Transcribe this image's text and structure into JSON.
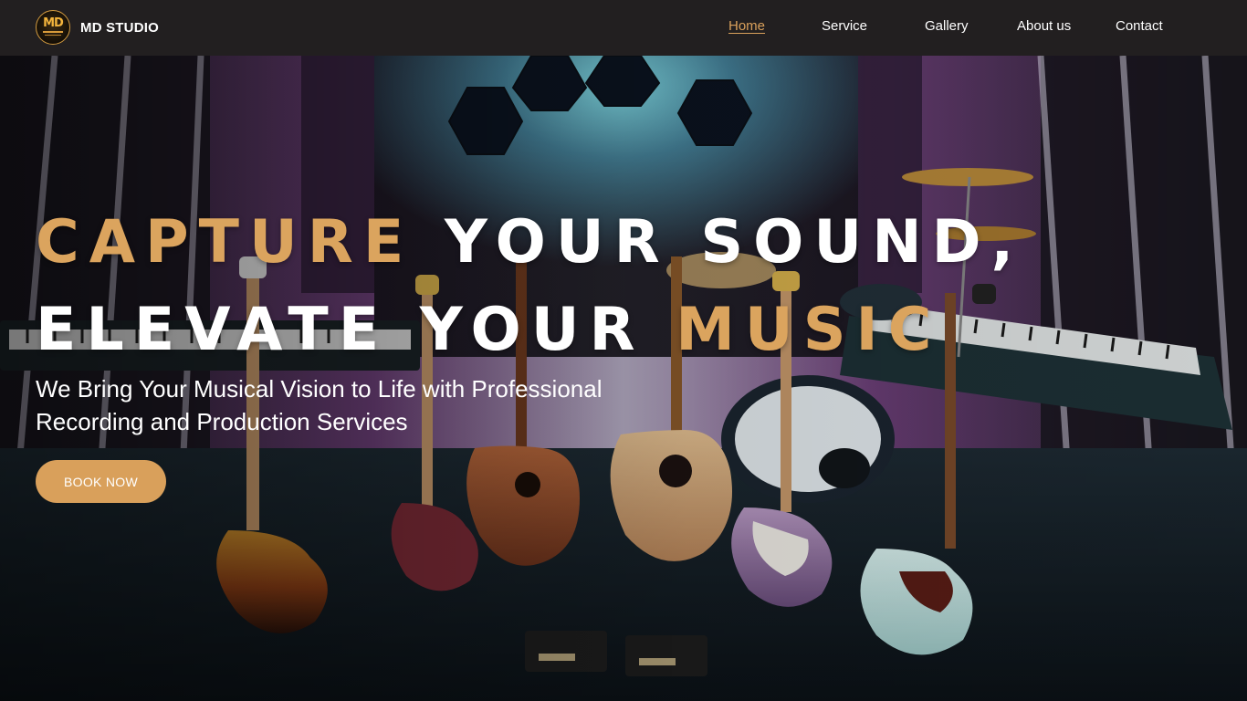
{
  "brand": {
    "logo_text": "MD",
    "name": "MD STUDIO"
  },
  "nav": {
    "items": [
      {
        "label": "Home",
        "active": true
      },
      {
        "label": "Service",
        "active": false
      },
      {
        "label": "Gallery",
        "active": false
      },
      {
        "label": "About us",
        "active": false
      },
      {
        "label": "Contact",
        "active": false
      }
    ]
  },
  "hero": {
    "headline": {
      "line1_gold": "CAPTURE",
      "line1_white": "YOUR SOUND,",
      "line2_white": "ELEVATE YOUR",
      "line2_gold": "MUSIC"
    },
    "subheadline": "We Bring Your Musical Vision to Life with Professional Recording and Production Services",
    "cta_label": "BOOK NOW",
    "background_description": "recording-studio-instruments-photo"
  },
  "colors": {
    "accent_gold": "#d9a05b",
    "navbar_bg": "#221f20",
    "text_white": "#ffffff"
  },
  "icons": {
    "logo": "md-studio-logo-icon"
  }
}
